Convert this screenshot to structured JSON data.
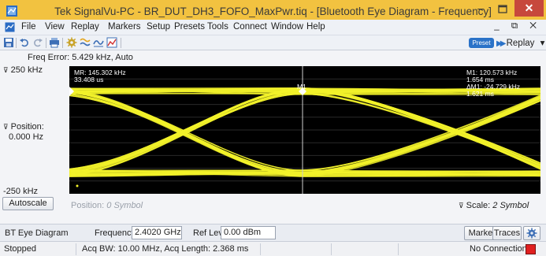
{
  "window": {
    "title": "Tek SignalVu-PC - BR_DUT_DH3_FOFO_MaxPwr.tiq - [Bluetooth Eye Diagram - Frequency]",
    "min_glyph": "–",
    "close_glyph": "✕"
  },
  "menu": {
    "items": [
      "File",
      "View",
      "Replay",
      "Markers",
      "Setup",
      "Presets",
      "Tools",
      "Connect",
      "Window",
      "Help"
    ],
    "doc_controls": "_ ⧉ ✕"
  },
  "toolbar": {
    "preset_label": "Preset",
    "replay_label": "Replay",
    "replay_caret": "▾",
    "icons": [
      "save-icon",
      "undo-icon",
      "redo-icon",
      "print-icon",
      "settings-icon",
      "acquire-icon",
      "analysis-icon",
      "chart-icon"
    ]
  },
  "display": {
    "freq_error": "Freq Error: 5.429 kHz, Auto",
    "y_top": "250 kHz",
    "y_position_label": "Position:",
    "y_position_value": "0.000 Hz",
    "y_bottom": "-250 kHz",
    "y_top_glyph": "⊽",
    "y_pos_glyph": "⊽"
  },
  "markers": {
    "mr_line1": "MR: 145.302 kHz",
    "mr_line2": "33.408 us",
    "m1_tag": "M1",
    "m1_line1": "M1: 120.573 kHz",
    "m1_line2": "1.654 ms",
    "delta_line1": "ΔM1: -24.729 kHz",
    "delta_line2": "1.621 ms"
  },
  "controls": {
    "autoscale_label": "Autoscale",
    "position_label": "Position:",
    "position_value": "0 Symbol",
    "scale_glyph": "⊽",
    "scale_label": "Scale:",
    "scale_value": "2 Symbol"
  },
  "bottom_bar": {
    "display_name": "BT Eye Diagram",
    "frequency_label": "Frequency",
    "frequency_value": "2.4020 GHz",
    "reflev_label": "Ref Lev",
    "reflev_value": "0.00 dBm",
    "markers_button": "Markers",
    "traces_button": "Traces"
  },
  "status_bar": {
    "state": "Stopped",
    "acq_info": "Acq BW: 10.00 MHz, Acq Length: 2.368 ms",
    "connection": "No Connection:"
  },
  "colors": {
    "title_bar": "#f2c240",
    "trace": "#f2f22a",
    "plot_bg": "#000000",
    "close_button": "#c7483c",
    "connection_indicator": "#e02020"
  }
}
